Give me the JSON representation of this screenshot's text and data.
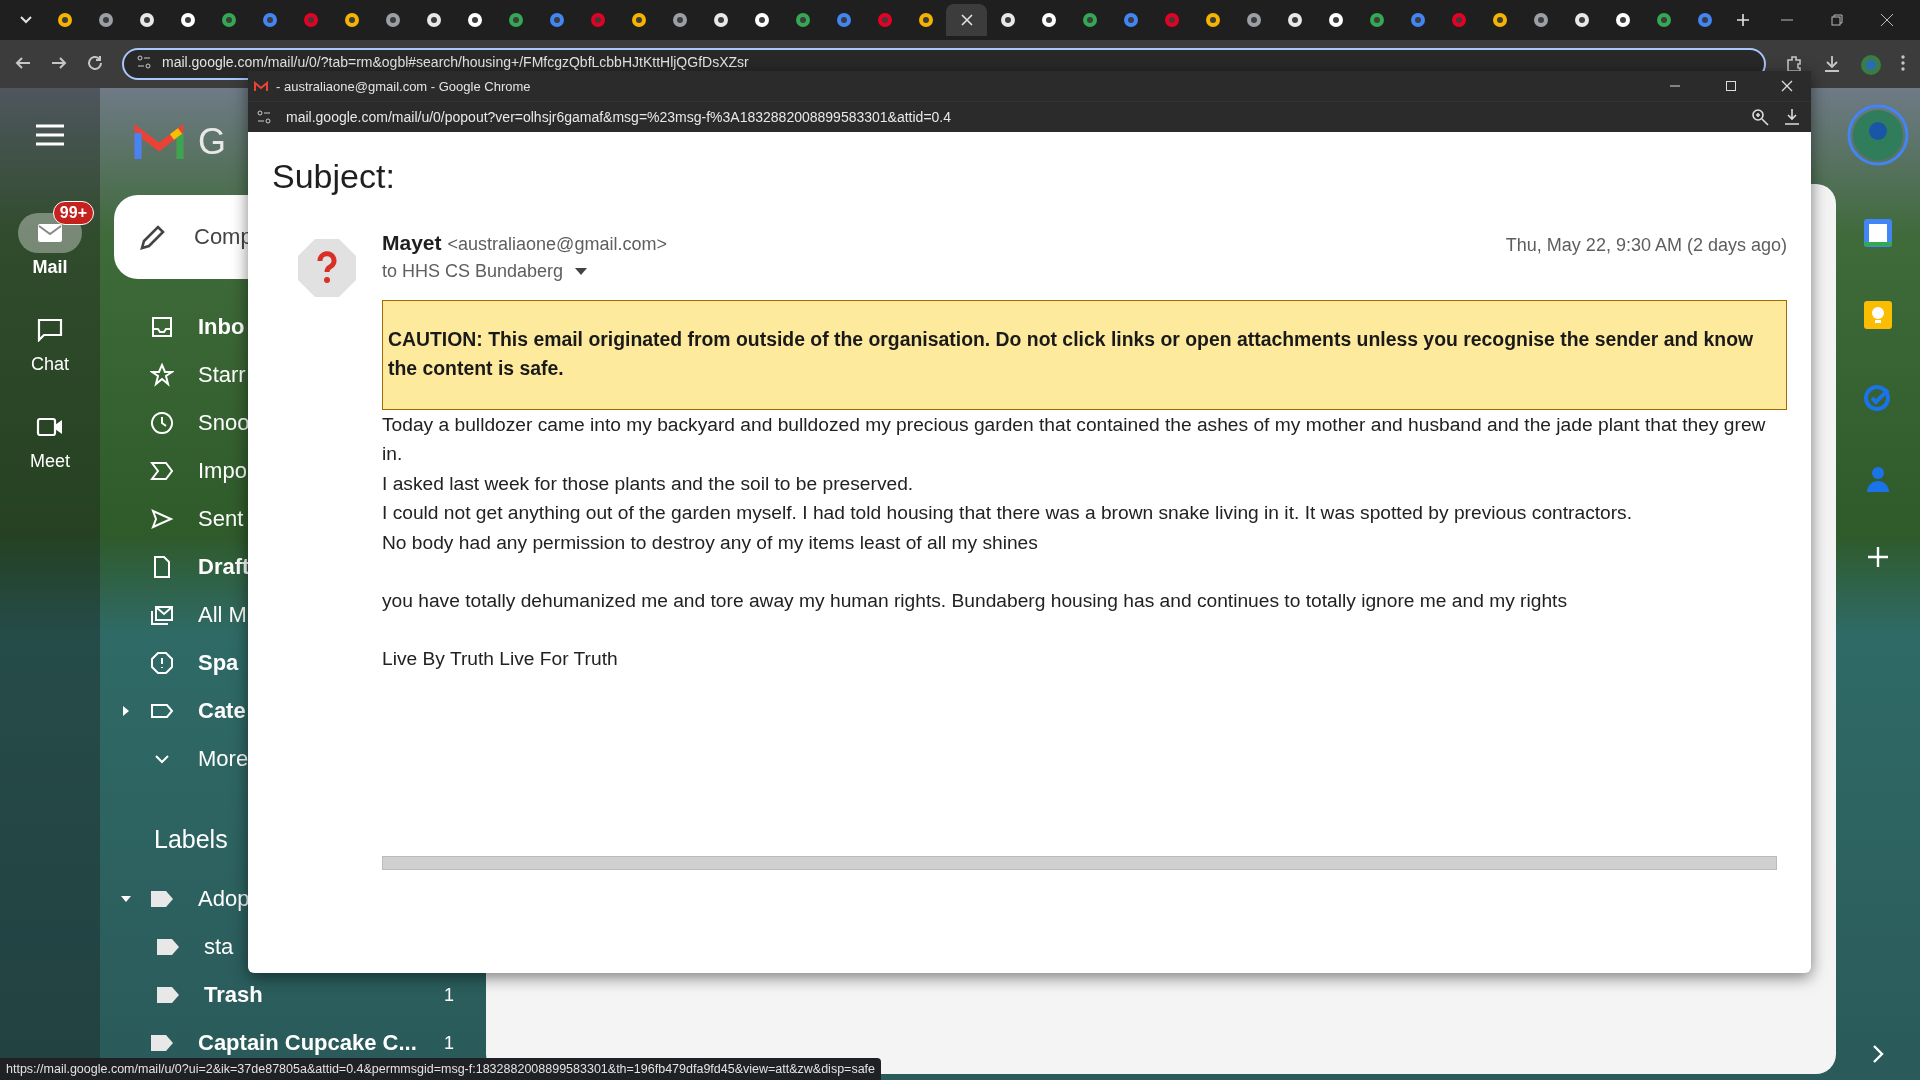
{
  "browser": {
    "tabs": [
      {
        "selected": false
      },
      {
        "selected": false
      },
      {
        "selected": false
      },
      {
        "selected": false
      },
      {
        "selected": false
      },
      {
        "selected": false
      },
      {
        "selected": false
      },
      {
        "selected": false
      },
      {
        "selected": false
      },
      {
        "selected": false
      },
      {
        "selected": false
      },
      {
        "selected": false
      },
      {
        "selected": false
      },
      {
        "selected": false
      },
      {
        "selected": false
      },
      {
        "selected": false
      },
      {
        "selected": false
      },
      {
        "selected": false
      },
      {
        "selected": false
      },
      {
        "selected": false
      },
      {
        "selected": false
      },
      {
        "selected": false
      },
      {
        "selected": true
      },
      {
        "selected": false
      },
      {
        "selected": false
      },
      {
        "selected": false
      },
      {
        "selected": false
      },
      {
        "selected": false
      },
      {
        "selected": false
      },
      {
        "selected": false
      },
      {
        "selected": false
      },
      {
        "selected": false
      },
      {
        "selected": false
      },
      {
        "selected": false
      },
      {
        "selected": false
      },
      {
        "selected": false
      },
      {
        "selected": false
      },
      {
        "selected": false
      },
      {
        "selected": false
      },
      {
        "selected": false
      },
      {
        "selected": false
      }
    ],
    "address_bar": {
      "url": "mail.google.com/mail/u/0/?tab=rm&ogbl#search/housing+/FMfcgzQbfLcbbHJtKttHljQGfDsXZsr"
    }
  },
  "gmail": {
    "logo_text": "G",
    "rail": [
      {
        "label": "Mail",
        "selected": true,
        "badge": "99+"
      },
      {
        "label": "Chat",
        "selected": false
      },
      {
        "label": "Meet",
        "selected": false
      }
    ],
    "compose": "Comp",
    "nav": [
      {
        "label": "Inbo",
        "unread": true
      },
      {
        "label": "Starr",
        "unread": false
      },
      {
        "label": "Snoo",
        "unread": false
      },
      {
        "label": "Impo",
        "unread": false
      },
      {
        "label": "Sent",
        "unread": false
      },
      {
        "label": "Draft",
        "unread": true
      },
      {
        "label": "All M",
        "unread": false
      },
      {
        "label": "Spa",
        "unread": true
      },
      {
        "label": "Cate",
        "unread": true,
        "expanded": false
      },
      {
        "label": "More",
        "unread": false
      }
    ],
    "labels_heading": "Labels",
    "labels": [
      {
        "label": "Adop",
        "unread": false,
        "expanded": true,
        "children": [
          {
            "label": "sta",
            "unread": false
          },
          {
            "label": "Trash",
            "unread": true,
            "count": "1"
          }
        ]
      },
      {
        "label": "Captain Cupcake C...",
        "unread": true,
        "count": "1"
      }
    ]
  },
  "popup": {
    "title": "- australiaone@gmail.com - Google Chrome",
    "url": "mail.google.com/mail/u/0/popout?ver=olhsjr6gamaf&msg=%23msg-f%3A1832882008899583301&attid=0.4",
    "subject": "Subject:",
    "sender_name": "Mayet",
    "sender_email": "<australiaone@gmail.com>",
    "recipient": "to HHS CS Bundaberg",
    "date": "Thu, May 22, 9:30 AM (2 days ago)",
    "caution": "CAUTION: This email originated from outside of the organisation. Do not click links or open attachments unless you recognise the sender and know the content is safe.",
    "body": [
      {
        "lines": [
          "Today a bulldozer came into my backyard and bulldozed my precious garden that contained the ashes of my mother and husband and the jade plant that they grew in.",
          "I asked last week for those plants and the soil to be preserved.",
          "I could not get anything out of the garden myself. I had told housing that there was a brown snake living in it. It was spotted by previous contractors.",
          "No body had any permission to destroy any of my items least of all my shines"
        ]
      },
      {
        "lines": [
          "you have totally dehumanized me and tore away my human rights. Bundaberg housing has and continues to totally ignore me and my rights"
        ]
      },
      {
        "lines": [
          "Live By Truth Live For Truth"
        ]
      }
    ]
  },
  "status_bar": {
    "url": "https://mail.google.com/mail/u/0?ui=2&ik=37de87805a&attid=0.4&permmsgid=msg-f:1832882008899583301&th=196fb479dfa9fd45&view=att&zw&disp=safe"
  }
}
